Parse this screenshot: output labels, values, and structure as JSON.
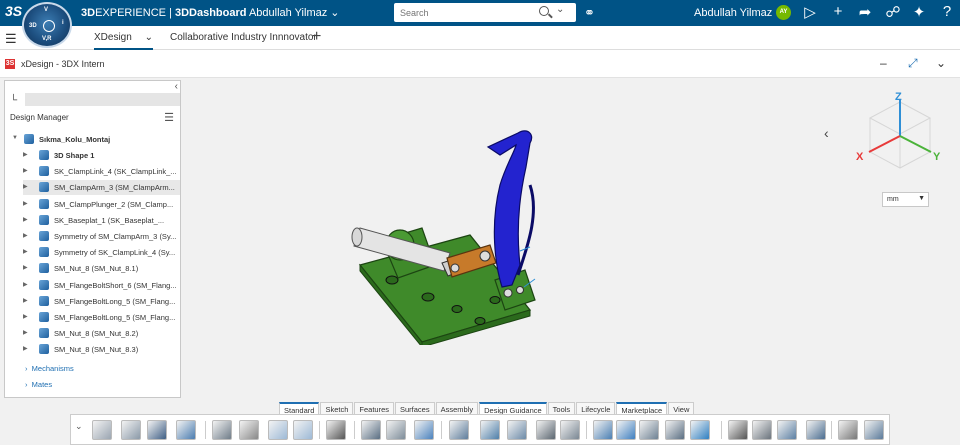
{
  "header": {
    "ds_logo": "3S",
    "compass_labels": {
      "top": "V",
      "left": "3D",
      "right": "i",
      "bottom": "V,R"
    },
    "brand_bold": "3D",
    "brand_rest": "EXPERIENCE",
    "separator": "|",
    "app_name": "3DDashboard",
    "user_name": "Abdullah Yilmaz",
    "search_placeholder": "Search",
    "user_short": "Abdullah Yilmaz",
    "avatar_initials": "AY"
  },
  "tabs": [
    {
      "label": "XDesign",
      "active": true
    },
    {
      "label": "Collaborative Industry Innnovator",
      "active": false
    }
  ],
  "app": {
    "title": "xDesign - 3DX Intern",
    "icon_label": "3S"
  },
  "design_manager": {
    "title": "Design Manager",
    "root": "Sıkma_Kolu_Montaj",
    "items": [
      {
        "label": "3D Shape 1",
        "bold": true,
        "selected": false
      },
      {
        "label": "SK_ClampLink_4 (SK_ClampLink_...",
        "bold": false,
        "selected": false
      },
      {
        "label": "SM_ClampArm_3 (SM_ClampArm...",
        "bold": false,
        "selected": true
      },
      {
        "label": "SM_ClampPlunger_2 (SM_Clamp...",
        "bold": false,
        "selected": false
      },
      {
        "label": "SK_Baseplat_1 (SK_Baseplat_...",
        "bold": false,
        "selected": false
      },
      {
        "label": "Symmetry of SM_ClampArm_3 (Sy...",
        "bold": false,
        "selected": false
      },
      {
        "label": "Symmetry of SK_ClampLink_4 (Sy...",
        "bold": false,
        "selected": false
      },
      {
        "label": "SM_Nut_8 (SM_Nut_8.1)",
        "bold": false,
        "selected": false
      },
      {
        "label": "SM_FlangeBoltShort_6 (SM_Flang...",
        "bold": false,
        "selected": false
      },
      {
        "label": "SM_FlangeBoltLong_5 (SM_Flang...",
        "bold": false,
        "selected": false
      },
      {
        "label": "SM_FlangeBoltLong_5 (SM_Flang...",
        "bold": false,
        "selected": false
      },
      {
        "label": "SM_Nut_8 (SM_Nut_8.2)",
        "bold": false,
        "selected": false
      },
      {
        "label": "SM_Nut_8 (SM_Nut_8.3)",
        "bold": false,
        "selected": false
      }
    ],
    "mechanisms": "Mechanisms",
    "mates": "Mates"
  },
  "viewport": {
    "axis_z": "Z",
    "axis_x": "X",
    "axis_y": "Y",
    "unit": "mm"
  },
  "section_tabs": [
    {
      "label": "Standard",
      "active": true
    },
    {
      "label": "Sketch",
      "active": false
    },
    {
      "label": "Features",
      "active": false
    },
    {
      "label": "Surfaces",
      "active": false
    },
    {
      "label": "Assembly",
      "active": false
    },
    {
      "label": "Design Guidance",
      "active": true
    },
    {
      "label": "Tools",
      "active": false
    },
    {
      "label": "Lifecycle",
      "active": false
    },
    {
      "label": "Marketplace",
      "active": true
    },
    {
      "label": "View",
      "active": false
    }
  ],
  "colors": {
    "topbar": "#005386",
    "model_green": "#3f8a2a",
    "clamp_blue": "#2222c8",
    "link_orange": "#c77a2a",
    "axis_x": "#e83a3a",
    "axis_y": "#4bb33a",
    "axis_z": "#2f8fd6"
  }
}
